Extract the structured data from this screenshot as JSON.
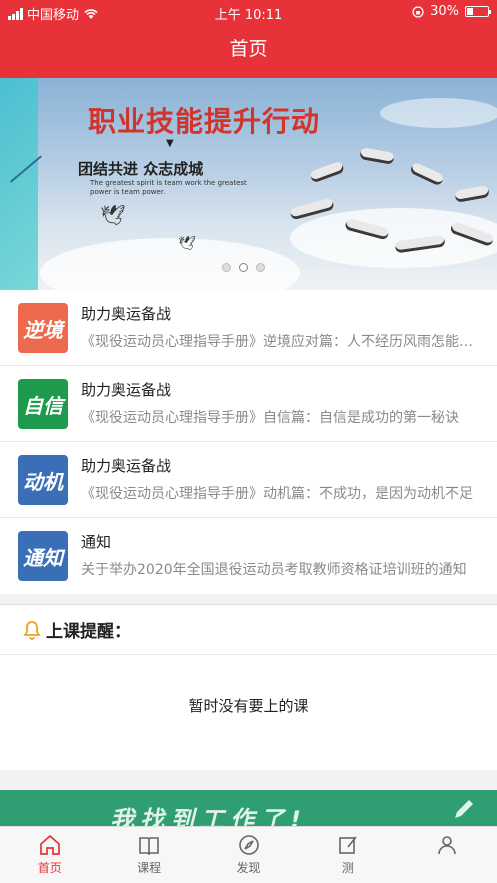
{
  "statusbar": {
    "carrier": "中国移动",
    "time": "上午 10:11",
    "battery": "30%",
    "battery_level": 0.3
  },
  "navbar": {
    "title": "首页"
  },
  "banner": {
    "title": "职业技能提升行动",
    "subtitle": "团结共进  众志成城",
    "subtitle_en": "The greatest spirit is team work the greatest power is team power.",
    "slide_count": 3,
    "active_slide": 1
  },
  "news": [
    {
      "icon": "逆境",
      "icon_color": "#ee6a4e",
      "title": "助力奥运备战",
      "desc": "《现役运动员心理指导手册》逆境应对篇：人不经历风雨怎能见彩虹"
    },
    {
      "icon": "自信",
      "icon_color": "#1e9a4c",
      "title": "助力奥运备战",
      "desc": "《现役运动员心理指导手册》自信篇：自信是成功的第一秘诀"
    },
    {
      "icon": "动机",
      "icon_color": "#3a6fb8",
      "title": "助力奥运备战",
      "desc": "《现役运动员心理指导手册》动机篇：不成功，是因为动机不足"
    },
    {
      "icon": "通知",
      "icon_color": "#3a6fb8",
      "title": "通知",
      "desc": "关于举办2020年全国退役运动员考取教师资格证培训班的通知"
    }
  ],
  "reminder": {
    "title": "上课提醒：",
    "empty_text": "暂时没有要上的课"
  },
  "promo": {
    "text": "我找到工作了!"
  },
  "tabs": [
    {
      "label": "首页",
      "icon": "home-icon",
      "active": true
    },
    {
      "label": "课程",
      "icon": "book-icon",
      "active": false
    },
    {
      "label": "发现",
      "icon": "compass-icon",
      "active": false
    },
    {
      "label": "测",
      "icon": "edit-icon",
      "active": false
    },
    {
      "label": "",
      "icon": "user-icon",
      "active": false
    }
  ]
}
